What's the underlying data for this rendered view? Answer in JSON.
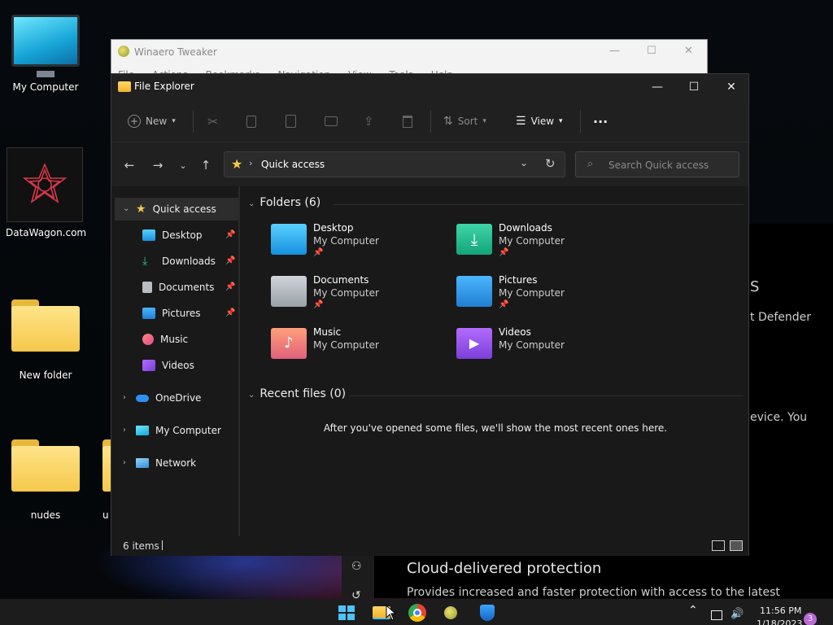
{
  "desktop": {
    "icons": [
      {
        "label": "My Computer"
      },
      {
        "label": "DataWagon.com"
      },
      {
        "label": "New folder"
      },
      {
        "label": "nudes"
      },
      {
        "label": "u"
      }
    ]
  },
  "background_window": {
    "title": "Winaero Tweaker",
    "menu": [
      "File",
      "Actions",
      "Bookmarks",
      "Navigation",
      "View",
      "Tools",
      "Help"
    ]
  },
  "security_window": {
    "heading_fragment": "s",
    "defender_fragment": "t Defender",
    "device_fragment": "evice. You",
    "cloud_title": "Cloud-delivered protection",
    "cloud_desc": "Provides increased and faster protection with access to the latest"
  },
  "explorer": {
    "title": "File Explorer",
    "toolbar": {
      "new_label": "New",
      "sort_label": "Sort",
      "view_label": "View",
      "more_label": "···"
    },
    "address": {
      "location": "Quick access"
    },
    "search": {
      "placeholder": "Search Quick access"
    },
    "nav": {
      "quick_access": "Quick access",
      "pinned": [
        {
          "label": "Desktop",
          "pinned": true
        },
        {
          "label": "Downloads",
          "pinned": true
        },
        {
          "label": "Documents",
          "pinned": true
        },
        {
          "label": "Pictures",
          "pinned": true
        },
        {
          "label": "Music",
          "pinned": false
        },
        {
          "label": "Videos",
          "pinned": false
        }
      ],
      "onedrive": "OneDrive",
      "mycomputer": "My Computer",
      "network": "Network"
    },
    "folders_header": "Folders (6)",
    "folders": [
      {
        "name": "Desktop",
        "location": "My Computer",
        "pinned": true
      },
      {
        "name": "Downloads",
        "location": "My Computer",
        "pinned": true
      },
      {
        "name": "Documents",
        "location": "My Computer",
        "pinned": true
      },
      {
        "name": "Pictures",
        "location": "My Computer",
        "pinned": true
      },
      {
        "name": "Music",
        "location": "My Computer",
        "pinned": false
      },
      {
        "name": "Videos",
        "location": "My Computer",
        "pinned": false
      }
    ],
    "recent_header": "Recent files (0)",
    "recent_empty": "After you've opened some files, we'll show the most recent ones here.",
    "status_count": "6 items"
  },
  "taskbar": {
    "time": "11:56 PM",
    "date": "1/18/2023",
    "notification_count": "3"
  },
  "colors": {
    "accent": "#4cc2ff",
    "folder_yellow": "#f5c84a"
  }
}
